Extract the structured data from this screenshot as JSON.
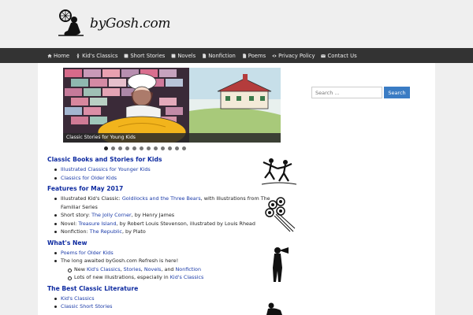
{
  "site": {
    "name": "byGosh.com"
  },
  "nav": [
    {
      "label": "Home",
      "icon": "home-icon"
    },
    {
      "label": "Kid's Classics",
      "icon": "child-icon"
    },
    {
      "label": "Short Stories",
      "icon": "book-icon"
    },
    {
      "label": "Novels",
      "icon": "book-icon"
    },
    {
      "label": "Nonfiction",
      "icon": "document-icon"
    },
    {
      "label": "Poems",
      "icon": "document-icon"
    },
    {
      "label": "Privacy Policy",
      "icon": "eye-icon"
    },
    {
      "label": "Contact Us",
      "icon": "envelope-icon"
    }
  ],
  "slider": {
    "caption": "Classic Stories for Young Kids",
    "dot_count": 12,
    "active_dot": 0
  },
  "sections": {
    "classic": {
      "title": "Classic Books and Stories for Kids",
      "items": [
        "Illustrated Classics for Younger Kids",
        "Classics for Older Kids"
      ]
    },
    "features": {
      "title": "Features for May 2017",
      "i1_pre": "Illustrated Kid's Classic: ",
      "i1_link": "Goldilocks and the Three Bears",
      "i1_post": ", with Illustrations from The Familiar Series",
      "i2_pre": "Short story: ",
      "i2_link": "The Jolly Corner",
      "i2_post": ", by Henry James",
      "i3_pre": "Novel: ",
      "i3_link": "Treasure Island",
      "i3_post": ", by Robert Louis Stevenson, illustrated by Louis Rhead",
      "i4_pre": "Nonfiction: ",
      "i4_link": "The Republic",
      "i4_post": ", by Plato"
    },
    "whatsnew": {
      "title": "What's New",
      "i1_link": "Poems for Older Kids",
      "i2_text": "The long awaited byGosh.com Refresh is here!",
      "sub1_pre": "New ",
      "sub1_l1": "Kid's Classics",
      "sub1_sep1": ", ",
      "sub1_l2": "Stories",
      "sub1_sep2": ", ",
      "sub1_l3": "Novels",
      "sub1_sep3": ", and ",
      "sub1_l4": "Nonfiction",
      "sub2_pre": "Lots of new illustrations, especially in ",
      "sub2_link": "Kid's Classics"
    },
    "best": {
      "title": "The Best Classic Literature",
      "i1_link": "Kid's Classics",
      "i2_link": "Classic Short Stories"
    }
  },
  "search": {
    "placeholder": "Search ...",
    "button": "Search"
  },
  "colors": {
    "nav_bg": "#333333",
    "link": "#1a3aa8",
    "heading": "#0d2aa0",
    "search_button": "#3a7cc4"
  }
}
